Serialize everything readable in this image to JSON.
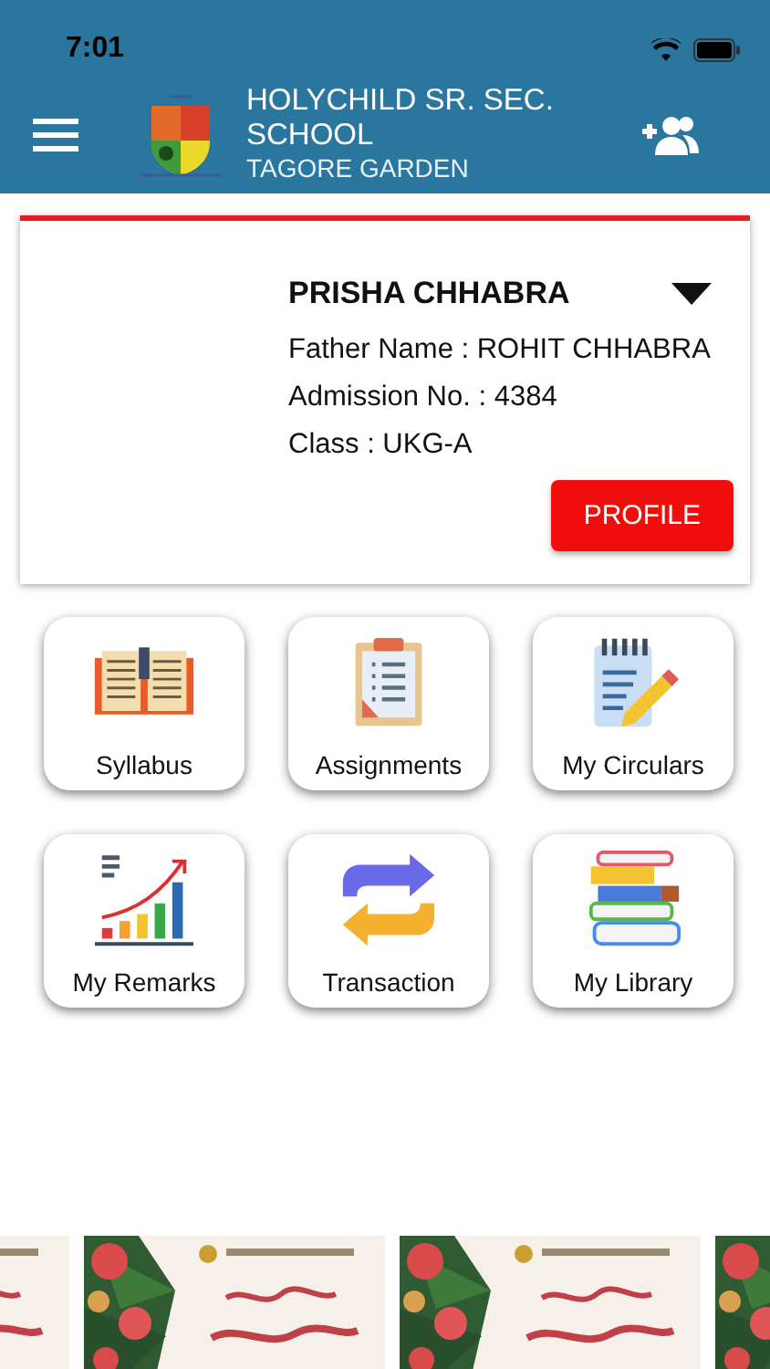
{
  "status_bar": {
    "time": "7:01"
  },
  "header": {
    "title": "HOLYCHILD SR. SEC. SCHOOL",
    "subtitle": "TAGORE GARDEN"
  },
  "student": {
    "name": "PRISHA CHHABRA",
    "details": [
      "Father Name : ROHIT CHHABRA",
      "Admission No. : 4384",
      "Class : UKG-A"
    ],
    "button": "PROFILE"
  },
  "tiles": [
    {
      "kind": "book",
      "label": "Syllabus"
    },
    {
      "kind": "clipboard",
      "label": "Assignments"
    },
    {
      "kind": "notepad",
      "label": "My Circulars"
    },
    {
      "kind": "chart",
      "label": "My Remarks"
    },
    {
      "kind": "exchange",
      "label": "Transaction"
    },
    {
      "kind": "books",
      "label": "My Library"
    }
  ]
}
